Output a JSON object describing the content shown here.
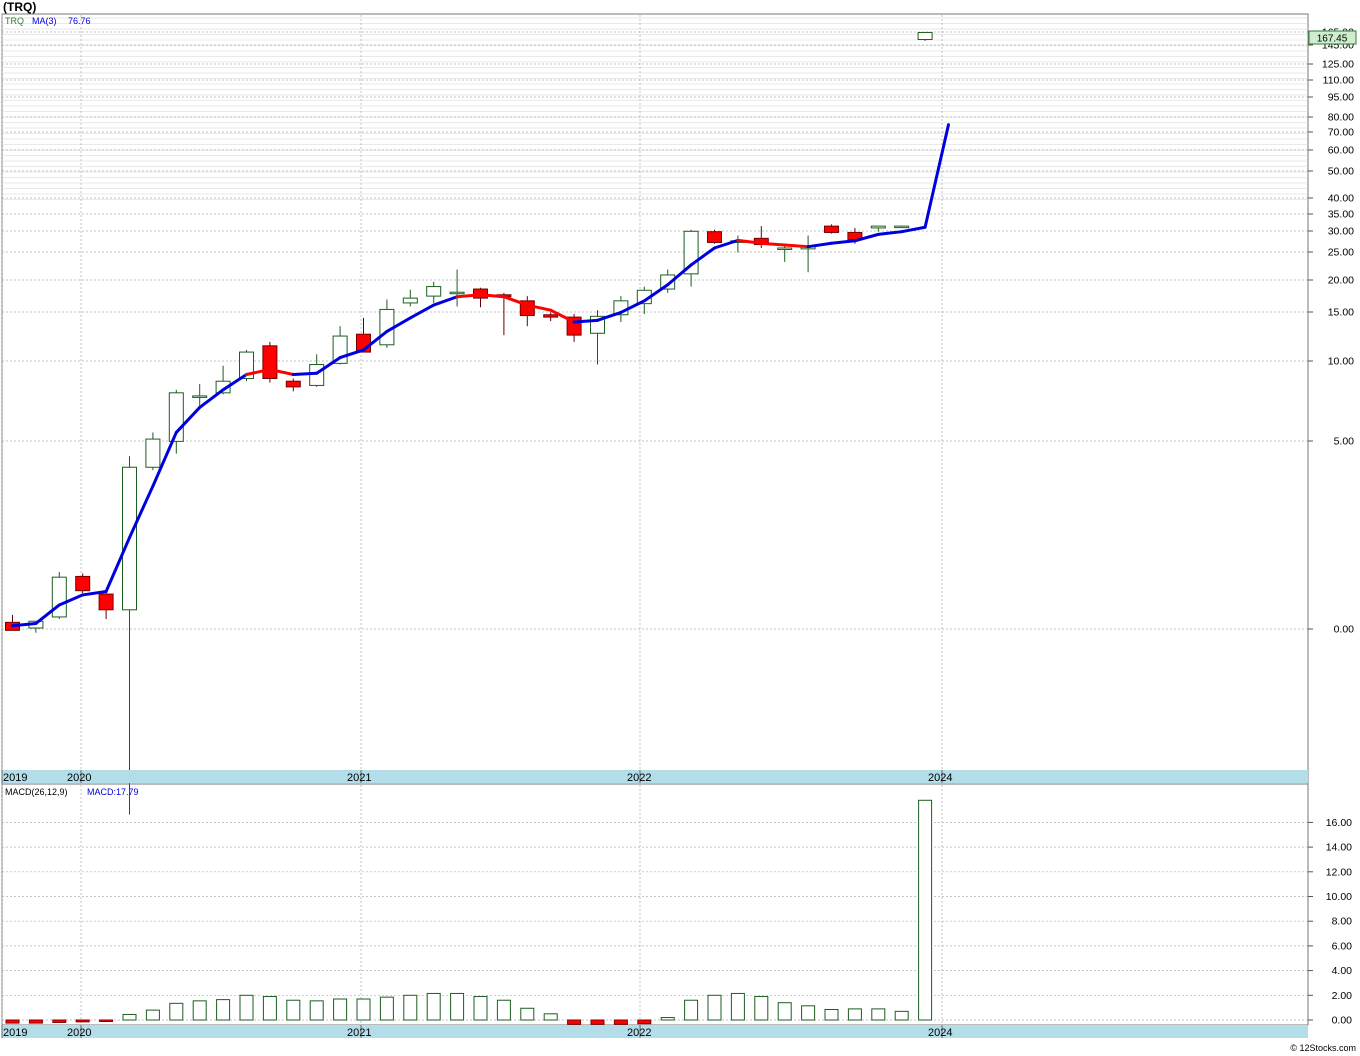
{
  "header": {
    "symbol": "(TRQ)",
    "legend_ticker": "TRQ",
    "legend_ma_label": "MA(3)",
    "legend_ma_value": "76.76",
    "last_price": "167.45",
    "macd_label": "MACD(26,12,9)",
    "macd_value_label": "MACD:17.79",
    "credit": "© 12Stocks.com"
  },
  "colors": {
    "up": "#2e7d32",
    "down": "#ff0000",
    "ma_up": "#0000dd",
    "ma_down": "#ff0000",
    "axis_band": "#b3dde8",
    "grid": "#aaaaaa"
  },
  "chart_data": [
    {
      "type": "candlestick",
      "title": "(TRQ)",
      "scale": "log",
      "price_ticks": [
        "165.00",
        "145.00",
        "125.00",
        "110.00",
        "95.00",
        "80.00",
        "70.00",
        "60.00",
        "50.00",
        "40.00",
        "35.00",
        "30.00",
        "25.00",
        "20.00",
        "15.00",
        "10.00",
        "5.00",
        "0.00"
      ],
      "x_labels": [
        "2019",
        "2020",
        "2021",
        "2022",
        "2024"
      ],
      "last_price": 167.45,
      "candles": [
        {
          "o": 1.05,
          "h": 1.12,
          "l": 0.98,
          "c": 0.98
        },
        {
          "o": 1.0,
          "h": 1.06,
          "l": 0.96,
          "c": 1.06
        },
        {
          "o": 1.1,
          "h": 1.62,
          "l": 1.08,
          "c": 1.55
        },
        {
          "o": 1.56,
          "h": 1.6,
          "l": 1.35,
          "c": 1.38
        },
        {
          "o": 1.34,
          "h": 1.4,
          "l": 1.08,
          "c": 1.17
        },
        {
          "o": 1.17,
          "h": 4.4,
          "l": 0.2,
          "c": 4.0
        },
        {
          "o": 4.0,
          "h": 5.4,
          "l": 3.9,
          "c": 5.1
        },
        {
          "o": 5.0,
          "h": 7.8,
          "l": 4.5,
          "c": 7.6
        },
        {
          "o": 7.4,
          "h": 8.2,
          "l": 6.8,
          "c": 7.4
        },
        {
          "o": 7.6,
          "h": 9.6,
          "l": 7.5,
          "c": 8.4
        },
        {
          "o": 8.6,
          "h": 11.0,
          "l": 8.4,
          "c": 10.8
        },
        {
          "o": 11.4,
          "h": 11.8,
          "l": 8.3,
          "c": 8.6
        },
        {
          "o": 8.4,
          "h": 8.6,
          "l": 7.7,
          "c": 8.0
        },
        {
          "o": 8.1,
          "h": 10.6,
          "l": 8.0,
          "c": 9.7
        },
        {
          "o": 9.8,
          "h": 13.5,
          "l": 9.7,
          "c": 12.4
        },
        {
          "o": 12.6,
          "h": 14.5,
          "l": 10.9,
          "c": 10.8
        },
        {
          "o": 11.5,
          "h": 17.0,
          "l": 11.2,
          "c": 15.6
        },
        {
          "o": 16.5,
          "h": 18.5,
          "l": 16.0,
          "c": 17.2
        },
        {
          "o": 17.5,
          "h": 19.8,
          "l": 16.5,
          "c": 19.0
        },
        {
          "o": 18.1,
          "h": 22.0,
          "l": 16.0,
          "c": 18.1
        },
        {
          "o": 18.6,
          "h": 18.8,
          "l": 15.9,
          "c": 17.2
        },
        {
          "o": 17.7,
          "h": 18.0,
          "l": 12.5,
          "c": 17.4
        },
        {
          "o": 16.8,
          "h": 17.5,
          "l": 13.5,
          "c": 14.8
        },
        {
          "o": 14.9,
          "h": 15.2,
          "l": 14.1,
          "c": 14.6
        },
        {
          "o": 14.6,
          "h": 15.0,
          "l": 11.8,
          "c": 12.5
        },
        {
          "o": 12.7,
          "h": 15.5,
          "l": 9.7,
          "c": 14.7
        },
        {
          "o": 14.9,
          "h": 17.5,
          "l": 14.0,
          "c": 16.8
        },
        {
          "o": 16.4,
          "h": 19.0,
          "l": 15.0,
          "c": 18.4
        },
        {
          "o": 18.6,
          "h": 22.0,
          "l": 18.0,
          "c": 21.0
        },
        {
          "o": 21.2,
          "h": 31.0,
          "l": 19.0,
          "c": 30.6
        },
        {
          "o": 30.5,
          "h": 31.0,
          "l": 27.5,
          "c": 27.8
        },
        {
          "o": 27.8,
          "h": 29.5,
          "l": 25.5,
          "c": 28.2
        },
        {
          "o": 28.8,
          "h": 32.0,
          "l": 26.5,
          "c": 27.3
        },
        {
          "o": 26.4,
          "h": 27.0,
          "l": 23.5,
          "c": 26.5
        },
        {
          "o": 26.3,
          "h": 29.5,
          "l": 21.5,
          "c": 27.0
        },
        {
          "o": 32.0,
          "h": 32.5,
          "l": 30.0,
          "c": 30.3
        },
        {
          "o": 30.3,
          "h": 31.5,
          "l": 27.5,
          "c": 28.5
        },
        {
          "o": 31.5,
          "h": 32.0,
          "l": 30.5,
          "c": 32.0
        },
        {
          "o": 31.7,
          "h": 32.2,
          "l": 31.5,
          "c": 32.0
        },
        {
          "o": 160.0,
          "h": 170.0,
          "l": 158.0,
          "c": 170.0
        }
      ],
      "ma3": [
        1.02,
        1.04,
        1.22,
        1.33,
        1.37,
        2.18,
        3.4,
        5.4,
        6.7,
        7.8,
        8.9,
        9.3,
        8.9,
        9.0,
        10.3,
        11.0,
        12.9,
        14.5,
        16.2,
        17.4,
        17.7,
        17.4,
        16.2,
        15.5,
        14.0,
        14.2,
        15.2,
        16.8,
        19.3,
        22.9,
        26.5,
        28.3,
        27.6,
        27.2,
        26.8,
        27.6,
        28.2,
        29.8,
        30.5,
        31.7,
        76.76
      ],
      "ma3_trend": [
        "u",
        "u",
        "u",
        "u",
        "u",
        "u",
        "u",
        "u",
        "u",
        "u",
        "u",
        "d",
        "d",
        "u",
        "u",
        "u",
        "u",
        "u",
        "u",
        "u",
        "d",
        "d",
        "d",
        "d",
        "d",
        "u",
        "u",
        "u",
        "u",
        "u",
        "u",
        "u",
        "d",
        "d",
        "d",
        "u",
        "u",
        "u",
        "u",
        "u",
        "u"
      ]
    },
    {
      "type": "bar",
      "title": "MACD(26,12,9)",
      "series_label": "MACD:17.79",
      "y_ticks": [
        "16.00",
        "14.00",
        "12.00",
        "10.00",
        "8.00",
        "6.00",
        "4.00",
        "2.00",
        "0.00"
      ],
      "x_labels": [
        "2019",
        "2020",
        "2021",
        "2022",
        "2024"
      ],
      "values": [
        -0.25,
        -0.25,
        -0.2,
        -0.15,
        -0.1,
        0.45,
        0.8,
        1.35,
        1.55,
        1.65,
        2.0,
        1.9,
        1.6,
        1.55,
        1.7,
        1.7,
        1.85,
        2.0,
        2.15,
        2.15,
        1.9,
        1.6,
        0.95,
        0.5,
        -0.35,
        -0.35,
        -0.35,
        -0.3,
        0.2,
        1.6,
        2.0,
        2.15,
        1.9,
        1.4,
        1.15,
        0.85,
        0.9,
        0.9,
        0.7,
        17.79
      ]
    }
  ]
}
